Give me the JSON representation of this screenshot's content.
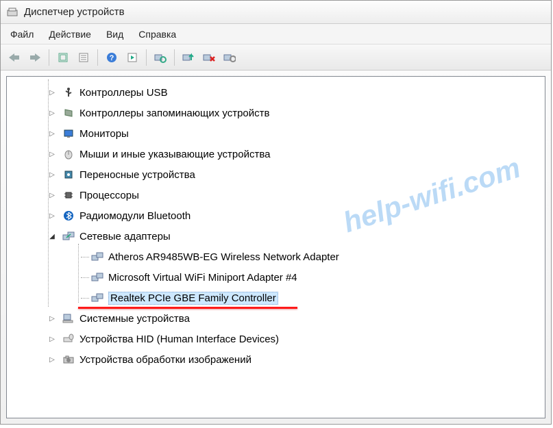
{
  "window": {
    "title": "Диспетчер устройств"
  },
  "menu": {
    "file": "Файл",
    "action": "Действие",
    "view": "Вид",
    "help": "Справка"
  },
  "toolbar": {
    "back": "back",
    "forward": "forward",
    "up": "show-hidden",
    "properties": "properties",
    "help": "help",
    "refresh": "refresh",
    "scan1": "scan-hardware",
    "update": "update-driver",
    "disable": "disable-device",
    "uninstall": "uninstall-device"
  },
  "tree": {
    "items": [
      {
        "label": "Контроллеры USB",
        "icon": "usb",
        "expanded": false
      },
      {
        "label": "Контроллеры запоминающих устройств",
        "icon": "storage",
        "expanded": false
      },
      {
        "label": "Мониторы",
        "icon": "monitor",
        "expanded": false
      },
      {
        "label": "Мыши и иные указывающие устройства",
        "icon": "mouse",
        "expanded": false
      },
      {
        "label": "Переносные устройства",
        "icon": "portable",
        "expanded": false
      },
      {
        "label": "Процессоры",
        "icon": "cpu",
        "expanded": false
      },
      {
        "label": "Радиомодули Bluetooth",
        "icon": "bluetooth",
        "expanded": false
      },
      {
        "label": "Сетевые адаптеры",
        "icon": "network",
        "expanded": true,
        "children": [
          {
            "label": "Atheros AR9485WB-EG Wireless Network Adapter",
            "icon": "netadapter"
          },
          {
            "label": "Microsoft Virtual WiFi Miniport Adapter #4",
            "icon": "netadapter"
          },
          {
            "label": "Realtek PCIe GBE Family Controller",
            "icon": "netadapter",
            "selected": true,
            "highlighted": true
          }
        ]
      },
      {
        "label": "Системные устройства",
        "icon": "system",
        "expanded": false
      },
      {
        "label": "Устройства HID (Human Interface Devices)",
        "icon": "hid",
        "expanded": false
      },
      {
        "label": "Устройства обработки изображений",
        "icon": "imaging",
        "expanded": false
      }
    ]
  },
  "watermark": "help-wifi.com"
}
